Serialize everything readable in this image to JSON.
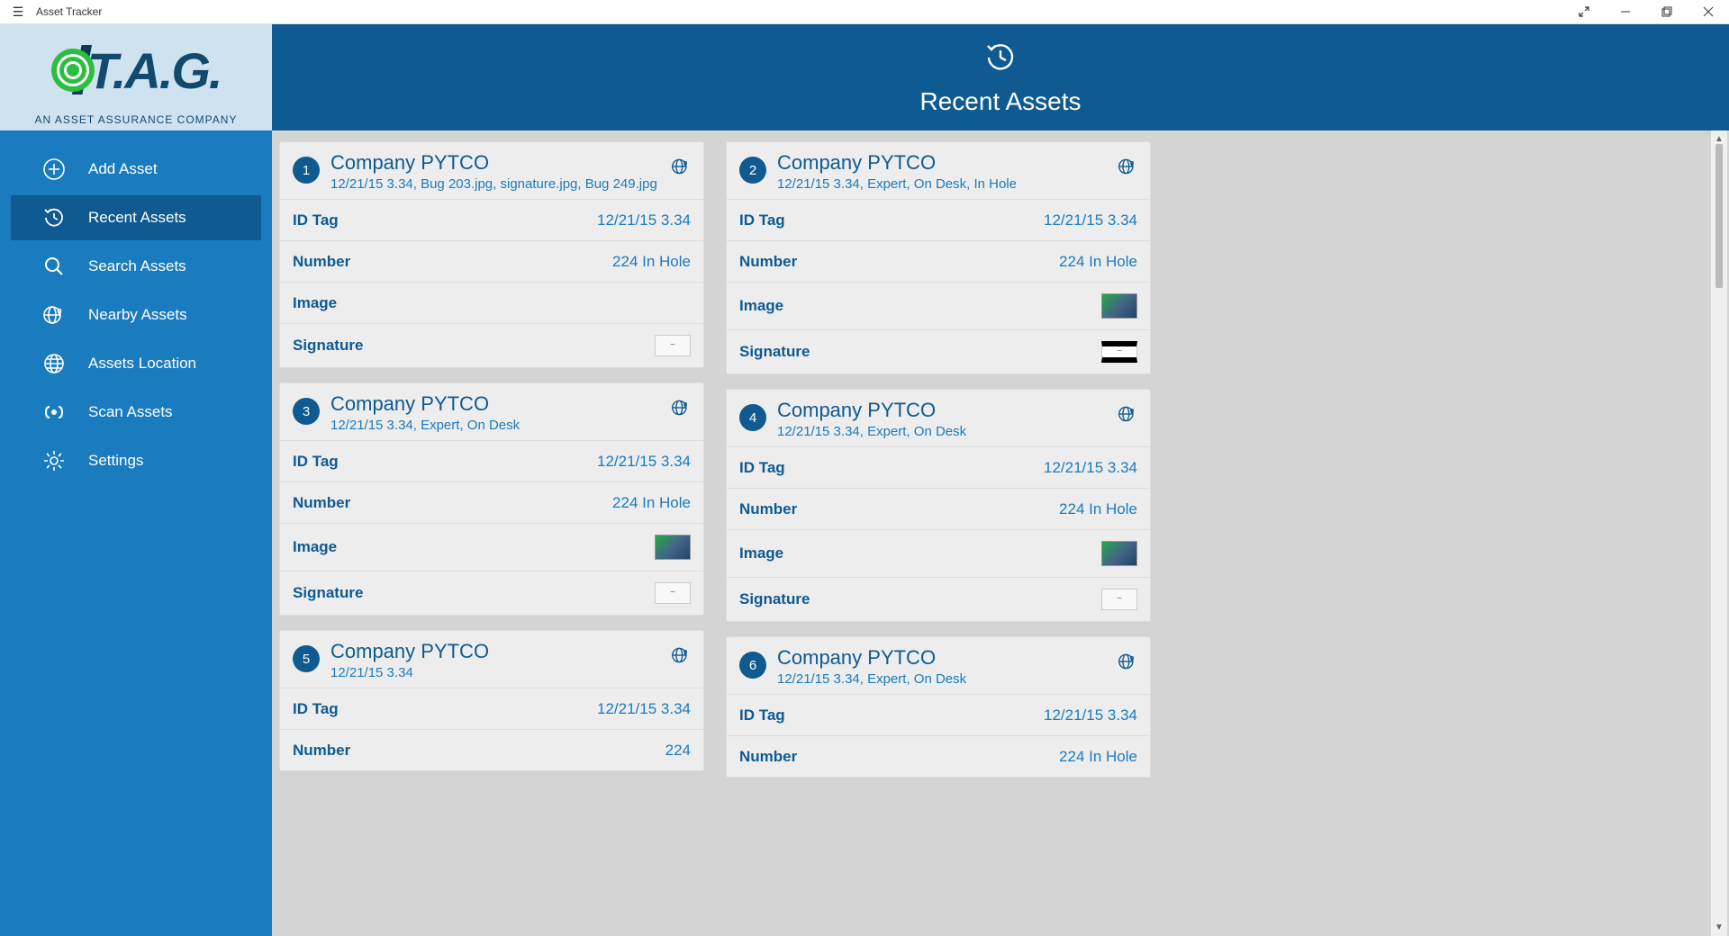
{
  "app_title": "Asset Tracker",
  "logo": {
    "text": "T.A.G.",
    "subtitle": "AN ASSET ASSURANCE COMPANY"
  },
  "nav": {
    "items": [
      {
        "label": "Add Asset",
        "icon": "plus"
      },
      {
        "label": "Recent Assets",
        "icon": "history",
        "active": true
      },
      {
        "label": "Search Assets",
        "icon": "search"
      },
      {
        "label": "Nearby Assets",
        "icon": "globe-pin"
      },
      {
        "label": "Assets Location",
        "icon": "globe"
      },
      {
        "label": "Scan Assets",
        "icon": "scan"
      },
      {
        "label": "Settings",
        "icon": "gear"
      }
    ]
  },
  "page": {
    "title": "Recent Assets"
  },
  "labels": {
    "id_tag": "ID Tag",
    "number": "Number",
    "image": "Image",
    "signature": "Signature"
  },
  "assets": [
    {
      "n": "1",
      "company": "Company PYTCO",
      "subtitle": "12/21/15 3.34, Bug 203.jpg, signature.jpg, Bug 249.jpg",
      "id_tag": "12/21/15 3.34",
      "number": "224 In Hole",
      "has_image": false,
      "has_sig": true,
      "sig_dark": false
    },
    {
      "n": "2",
      "company": "Company PYTCO",
      "subtitle": "12/21/15 3.34, Expert, On Desk, In Hole",
      "id_tag": "12/21/15 3.34",
      "number": "224 In Hole",
      "has_image": true,
      "has_sig": true,
      "sig_dark": true
    },
    {
      "n": "3",
      "company": "Company PYTCO",
      "subtitle": "12/21/15 3.34, Expert, On Desk",
      "id_tag": "12/21/15 3.34",
      "number": "224 In Hole",
      "has_image": true,
      "has_sig": true,
      "sig_dark": false
    },
    {
      "n": "4",
      "company": "Company PYTCO",
      "subtitle": "12/21/15 3.34, Expert, On Desk",
      "id_tag": "12/21/15 3.34",
      "number": "224 In Hole",
      "has_image": true,
      "has_sig": true,
      "sig_dark": false
    },
    {
      "n": "5",
      "company": "Company PYTCO",
      "subtitle": "12/21/15 3.34",
      "id_tag": "12/21/15 3.34",
      "number": "224",
      "has_image": false,
      "has_sig": false,
      "short": true
    },
    {
      "n": "6",
      "company": "Company PYTCO",
      "subtitle": "12/21/15 3.34, Expert, On Desk",
      "id_tag": "12/21/15 3.34",
      "number": "224 In Hole",
      "has_image": false,
      "has_sig": false,
      "short": true
    }
  ]
}
